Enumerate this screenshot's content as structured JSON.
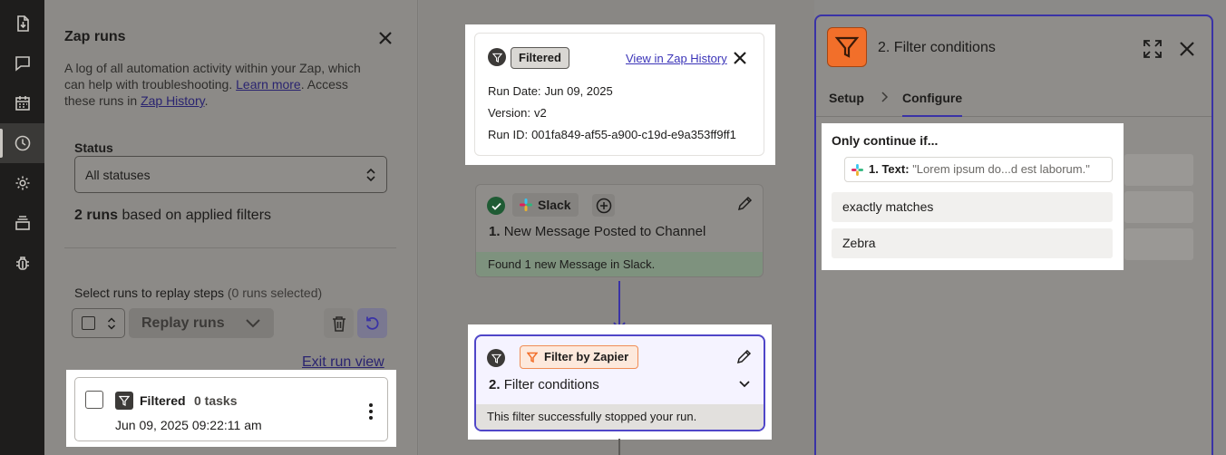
{
  "rail": {
    "items": [
      {
        "icon": "file-export-icon"
      },
      {
        "icon": "chat-icon"
      },
      {
        "icon": "calendar-icon"
      },
      {
        "icon": "history-clock-icon",
        "active": true
      },
      {
        "icon": "gear-icon"
      },
      {
        "icon": "stack-icon"
      },
      {
        "icon": "bug-icon"
      }
    ]
  },
  "runs": {
    "title": "Zap runs",
    "description_prefix": "A log of all automation activity within your Zap, which can help with troubleshooting. ",
    "learn_more": "Learn more",
    "description_mid": ". Access these runs in ",
    "zap_history": "Zap History",
    "description_suffix": ".",
    "status_label": "Status",
    "status_value": "All statuses",
    "count_bold": "2 runs",
    "count_rest": " based on applied filters",
    "replay_label": "Select runs to replay steps",
    "replay_selected": "(0 runs selected)",
    "replay_button": "Replay runs",
    "exit_link": "Exit run view",
    "run": {
      "status": "Filtered",
      "tasks": "0 tasks",
      "date": "Jun 09, 2025 09:22:11 am"
    }
  },
  "popup": {
    "badge": "Filtered",
    "view_link": "View in Zap History",
    "rows": [
      {
        "label": "Run Date:",
        "value": "Jun 09, 2025"
      },
      {
        "label": "Version:",
        "value": "v2"
      },
      {
        "label": "Run ID:",
        "value": "001fa849-af55-a900-c19d-e9a353ff9ff1"
      }
    ]
  },
  "slack_step": {
    "app": "Slack",
    "number": "1.",
    "title": "New Message Posted to Channel",
    "footer": "Found 1 new Message in Slack."
  },
  "filter_step": {
    "app": "Filter by Zapier",
    "number": "2.",
    "title": "Filter conditions",
    "footer": "This filter successfully stopped your run."
  },
  "config": {
    "title": "2. Filter conditions",
    "tabs": [
      {
        "label": "Setup"
      },
      {
        "label": "Configure",
        "active": true
      }
    ],
    "only_continue": "Only continue if...",
    "field_label": "1. Text:",
    "field_value": "\"Lorem ipsum do...d est laborum.\"",
    "operator": "exactly matches",
    "value": "Zebra"
  },
  "colors": {
    "accent": "#3a33a6",
    "filter_orange": "#f26f2a",
    "success": "#1f5b34"
  }
}
